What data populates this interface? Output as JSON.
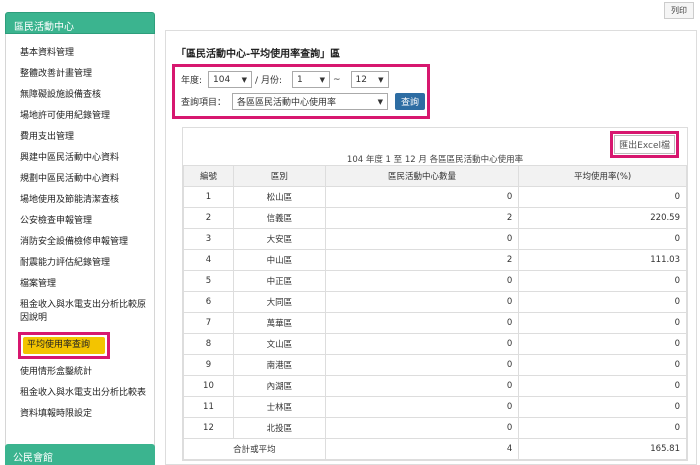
{
  "print_label": "列印",
  "sidebar": {
    "header": "區民活動中心",
    "items": [
      "基本資料管理",
      "整體改善計畫管理",
      "無障礙設施設備查核",
      "場地許可使用紀錄管理",
      "費用支出管理",
      "興建中區民活動中心資料",
      "規劃中區民活動中心資料",
      "場地使用及節能清潔查核",
      "公安檢查申報管理",
      "消防安全設備檢修申報管理",
      "耐震能力評估紀錄管理",
      "檔案管理",
      "租金收入與水電支出分析比較原因說明"
    ],
    "active_item": "平均使用率查詢",
    "items_after": [
      "使用情形盒鑿統計",
      "租金收入與水電支出分析比較表",
      "資料填報時限設定"
    ],
    "header2": "公民會館"
  },
  "main": {
    "title": "「區民活動中心-平均使用率查詢」區",
    "query": {
      "year_label": "年度:",
      "year_value": "104",
      "month_label": "/ 月份:",
      "month_from": "1",
      "tilde": "~",
      "month_to": "12",
      "item_label": "查詢項目：",
      "item_value": "各區區民活動中心使用率",
      "search_button": "查詢"
    },
    "export_button": "匯出Excel檔",
    "caption": "104 年度 1 至 12 月 各區區民活動中心使用率",
    "columns": [
      "編號",
      "區別",
      "區民活動中心數量",
      "平均使用率(%)"
    ],
    "rows": [
      [
        "1",
        "松山區",
        "0",
        "0"
      ],
      [
        "2",
        "信義區",
        "2",
        "220.59"
      ],
      [
        "3",
        "大安區",
        "0",
        "0"
      ],
      [
        "4",
        "中山區",
        "2",
        "111.03"
      ],
      [
        "5",
        "中正區",
        "0",
        "0"
      ],
      [
        "6",
        "大同區",
        "0",
        "0"
      ],
      [
        "7",
        "萬華區",
        "0",
        "0"
      ],
      [
        "8",
        "文山區",
        "0",
        "0"
      ],
      [
        "9",
        "南港區",
        "0",
        "0"
      ],
      [
        "10",
        "內湖區",
        "0",
        "0"
      ],
      [
        "11",
        "士林區",
        "0",
        "0"
      ],
      [
        "12",
        "北投區",
        "0",
        "0"
      ]
    ],
    "total": [
      "合計或平均",
      "4",
      "165.81"
    ]
  }
}
